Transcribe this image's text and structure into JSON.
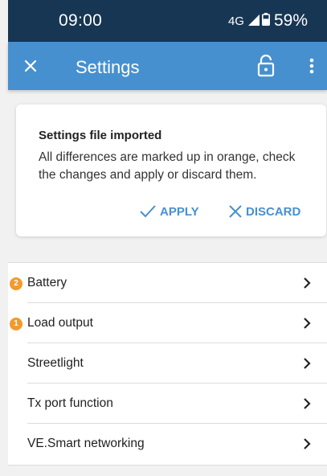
{
  "status_bar": {
    "time": "09:00",
    "network": "4G",
    "battery": "59%",
    "icons": [
      "signal-icon",
      "battery-icon"
    ]
  },
  "app_bar": {
    "title": "Settings",
    "icons": [
      "close-icon",
      "lock-open-icon",
      "more-vert-icon"
    ]
  },
  "card": {
    "title": "Settings file imported",
    "message": "All differences are marked up in orange, check the changes and apply or discard them.",
    "apply_label": "APPLY",
    "discard_label": "DISCARD",
    "icons": [
      "check-icon",
      "x-icon"
    ]
  },
  "settings_list": {
    "items": [
      {
        "label": "Battery",
        "badge": "2"
      },
      {
        "label": "Load output",
        "badge": "1"
      },
      {
        "label": "Streetlight",
        "badge": ""
      },
      {
        "label": "Tx port function",
        "badge": ""
      },
      {
        "label": "VE.Smart networking",
        "badge": ""
      }
    ]
  },
  "colors": {
    "status_bar": "#173654",
    "app_bar": "#4790d0",
    "accent": "#4790d0",
    "badge": "#f29a2e",
    "background": "#f1f1f1"
  }
}
